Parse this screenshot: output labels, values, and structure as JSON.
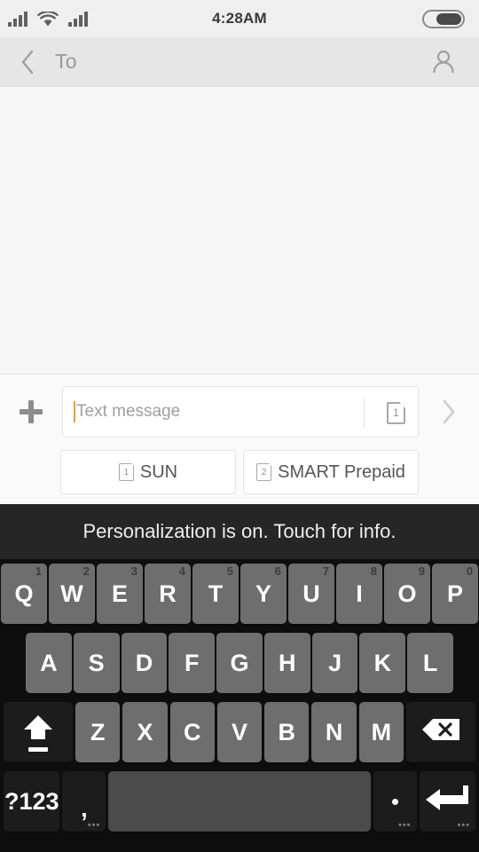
{
  "status_bar": {
    "time": "4:28AM",
    "signal1_icon": "signal-bars-icon",
    "wifi_icon": "wifi-icon",
    "signal2_icon": "signal-bars-icon",
    "battery_icon": "battery-icon"
  },
  "nav_bar": {
    "back_icon": "chevron-left-icon",
    "title": "To",
    "contact_icon": "person-icon"
  },
  "compose": {
    "attach_icon": "plus-icon",
    "placeholder": "Text message",
    "input_value": "",
    "sim_indicator": "1",
    "send_icon": "chevron-right-icon",
    "sim_buttons": [
      {
        "number": "1",
        "label": "SUN"
      },
      {
        "number": "2",
        "label": "SMART Prepaid"
      }
    ]
  },
  "keyboard": {
    "suggestion_text": "Personalization is on. Touch for info.",
    "row1": [
      {
        "key": "Q",
        "hint": "1"
      },
      {
        "key": "W",
        "hint": "2"
      },
      {
        "key": "E",
        "hint": "3"
      },
      {
        "key": "R",
        "hint": "4"
      },
      {
        "key": "T",
        "hint": "5"
      },
      {
        "key": "Y",
        "hint": "6"
      },
      {
        "key": "U",
        "hint": "7"
      },
      {
        "key": "I",
        "hint": "8"
      },
      {
        "key": "O",
        "hint": "9"
      },
      {
        "key": "P",
        "hint": "0"
      }
    ],
    "row2": [
      {
        "key": "A"
      },
      {
        "key": "S"
      },
      {
        "key": "D"
      },
      {
        "key": "F"
      },
      {
        "key": "G"
      },
      {
        "key": "H"
      },
      {
        "key": "J"
      },
      {
        "key": "K"
      },
      {
        "key": "L"
      }
    ],
    "row3": {
      "shift_icon": "shift-arrow-icon",
      "letters": [
        {
          "key": "Z"
        },
        {
          "key": "X"
        },
        {
          "key": "C"
        },
        {
          "key": "V"
        },
        {
          "key": "B"
        },
        {
          "key": "N"
        },
        {
          "key": "M"
        }
      ],
      "backspace_icon": "backspace-icon"
    },
    "row4": {
      "symbols_label": "?123",
      "comma": ",",
      "comma_hint": "•••",
      "space": "",
      "period": ".",
      "period_hint": "•••",
      "enter_icon": "enter-arrow-icon",
      "enter_hint": "•••"
    }
  },
  "colors": {
    "accent_caret": "#ef9b3c",
    "keyboard_bg": "#0e0e0e",
    "key_bg": "#6e6e6e",
    "key_dark": "#1c1c1c"
  }
}
